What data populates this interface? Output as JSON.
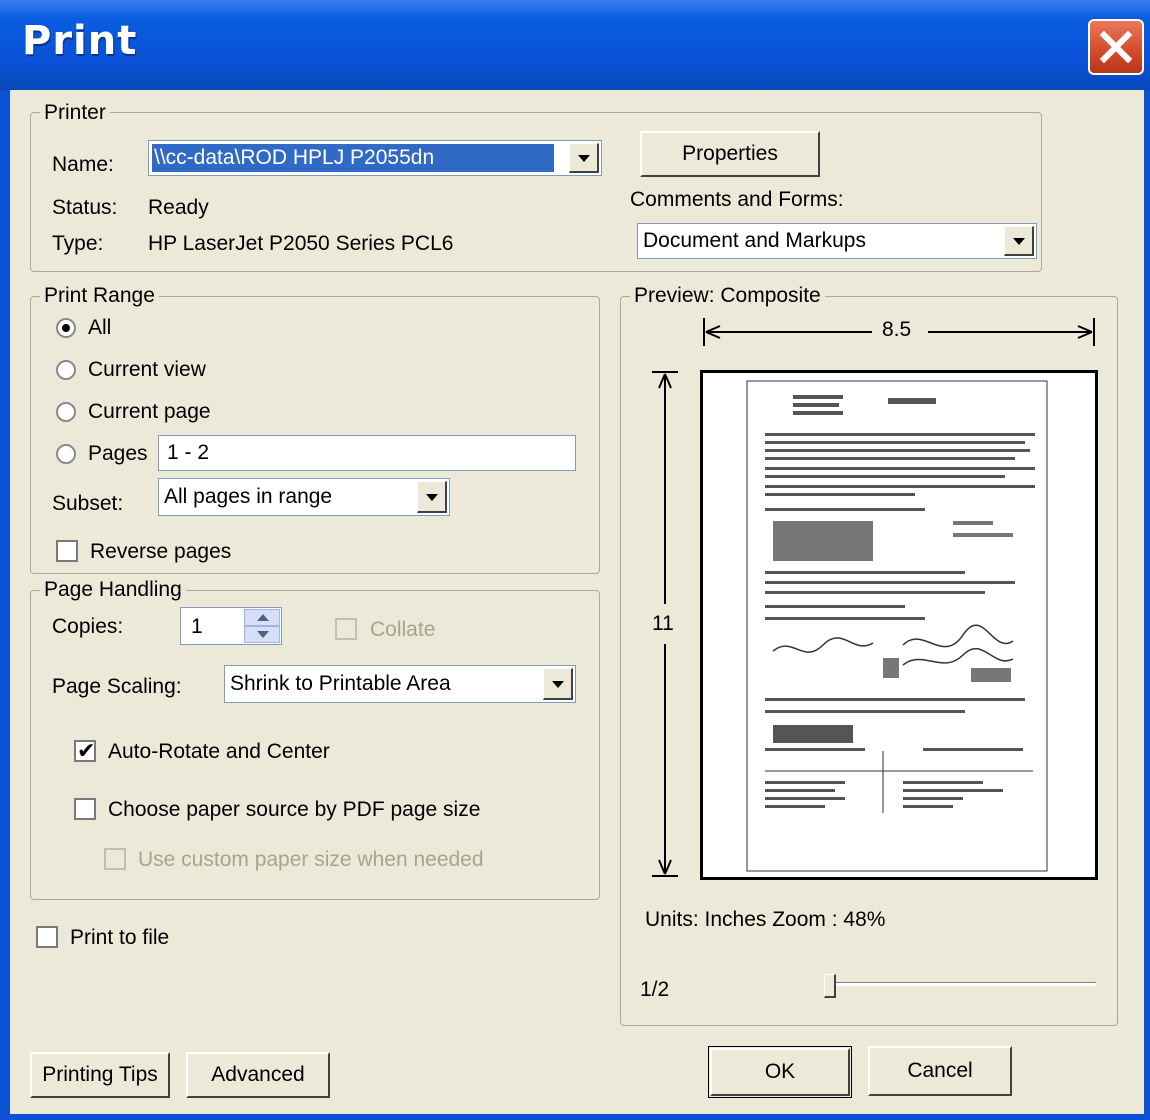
{
  "window": {
    "title": "Print"
  },
  "printer": {
    "group_label": "Printer",
    "name_label": "Name:",
    "name_value": "\\\\cc-data\\ROD HPLJ P2055dn",
    "status_label": "Status:",
    "status_value": "Ready",
    "type_label": "Type:",
    "type_value": "HP LaserJet P2050 Series PCL6",
    "properties_label": "Properties",
    "comments_label": "Comments and Forms:",
    "comments_value": "Document and Markups"
  },
  "print_range": {
    "group_label": "Print Range",
    "all_label": "All",
    "current_view_label": "Current view",
    "current_page_label": "Current page",
    "pages_label": "Pages",
    "pages_value": "1 - 2",
    "subset_label": "Subset:",
    "subset_value": "All pages in range",
    "reverse_label": "Reverse pages",
    "selected": "All"
  },
  "page_handling": {
    "group_label": "Page Handling",
    "copies_label": "Copies:",
    "copies_value": "1",
    "collate_label": "Collate",
    "scaling_label": "Page Scaling:",
    "scaling_value": "Shrink to Printable Area",
    "auto_rotate_label": "Auto-Rotate and Center",
    "auto_rotate_checked": true,
    "paper_source_label": "Choose paper source by PDF page size",
    "custom_paper_label": "Use custom paper size when needed"
  },
  "print_to_file_label": "Print to file",
  "preview": {
    "group_label": "Preview: Composite",
    "width_label": "8.5",
    "height_label": "11",
    "units_zoom": "Units: Inches Zoom :  48%",
    "page_indicator": "1/2",
    "slider_position": 0
  },
  "buttons": {
    "printing_tips": "Printing Tips",
    "advanced": "Advanced",
    "ok": "OK",
    "cancel": "Cancel"
  },
  "colors": {
    "title_bar": "#0a51d6",
    "dialog_bg": "#ece9d8",
    "selection": "#316ac5",
    "close_button": "#d24a2a"
  }
}
